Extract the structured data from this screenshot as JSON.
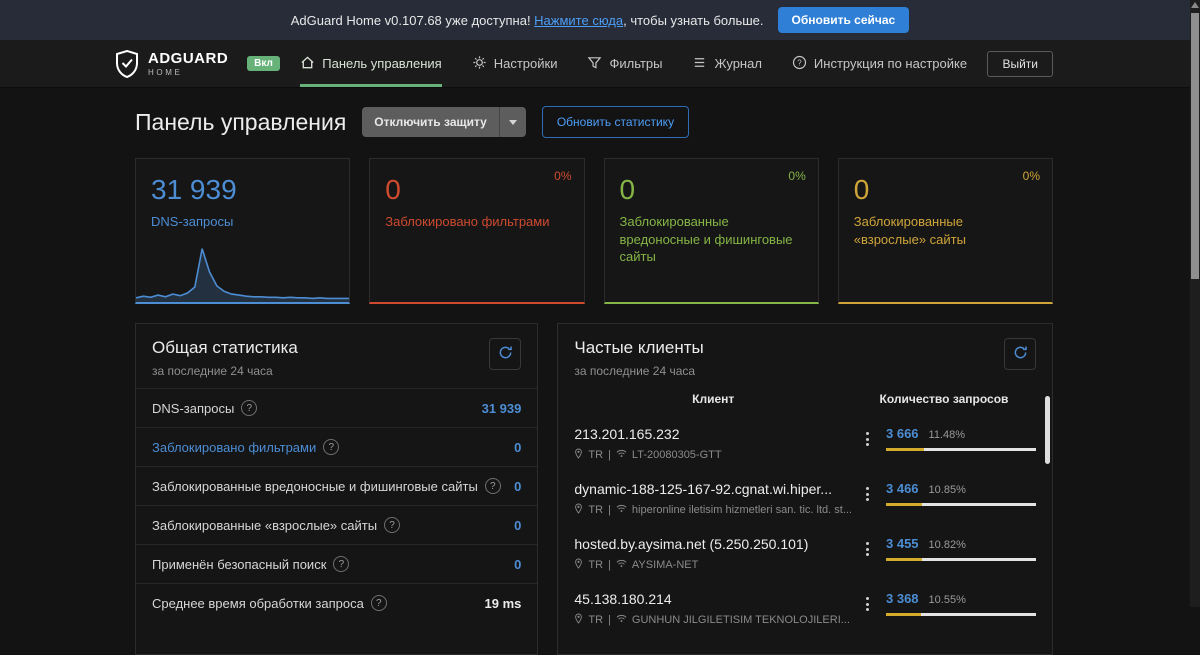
{
  "colors": {
    "accent_blue": "#4c8dd4",
    "red": "#cf4a2f",
    "green": "#85b546",
    "yellow": "#cfa53a",
    "link_blue": "#4d9ef7",
    "nav_active_green": "#67b279",
    "bar_yellow": "#d4ab2a",
    "bar_track": "#e3e3e3"
  },
  "icons": {
    "help_glyph": "?"
  },
  "notification": {
    "message_prefix": "AdGuard Home v0.107.68 уже доступна! ",
    "link_label": "Нажмите сюда",
    "message_suffix": ", чтобы узнать больше.",
    "update_button_label": "Обновить сейчас"
  },
  "header": {
    "brand_name": "ADGUARD",
    "brand_subtitle": "HOME",
    "status_badge": "Вкл",
    "nav_items": [
      {
        "label": "Панель управления",
        "icon": "dashboard-icon",
        "active": true
      },
      {
        "label": "Настройки",
        "icon": "gear-icon",
        "active": false
      },
      {
        "label": "Фильтры",
        "icon": "filter-icon",
        "active": false
      },
      {
        "label": "Журнал",
        "icon": "journal-icon",
        "active": false
      },
      {
        "label": "Инструкция по настройке",
        "icon": "help-icon",
        "active": false
      }
    ],
    "logout_label": "Выйти"
  },
  "page": {
    "title": "Панель управления",
    "disable_protection_label": "Отключить защиту",
    "refresh_statistics_label": "Обновить статистику"
  },
  "cards": [
    {
      "value": "31 939",
      "label": "DNS-запросы",
      "color": "#4c8dd4",
      "sparkline": [
        4,
        7,
        5,
        9,
        6,
        11,
        8,
        13,
        24,
        95,
        52,
        26,
        16,
        11,
        9,
        7,
        6,
        6,
        5,
        5,
        4,
        5,
        4,
        4,
        3,
        4,
        3,
        3,
        3,
        3
      ]
    },
    {
      "value": "0",
      "label": "Заблокировано фильтрами",
      "percent": "0%",
      "color": "#cf4a2f"
    },
    {
      "value": "0",
      "label": "Заблокированные вредоносные и фишинговые сайты",
      "percent": "0%",
      "color": "#85b546"
    },
    {
      "value": "0",
      "label": "Заблокированные «взрослые» сайты",
      "percent": "0%",
      "color": "#cfa53a"
    }
  ],
  "general_stats": {
    "title": "Общая статистика",
    "subtitle": "за последние 24 часа",
    "rows": [
      {
        "label": "DNS-запросы",
        "value": "31 939"
      },
      {
        "label": "Заблокировано фильтрами",
        "value": "0"
      },
      {
        "label": "Заблокированные вредоносные и фишинговые сайты",
        "value": "0"
      },
      {
        "label": "Заблокированные «взрослые» сайты",
        "value": "0"
      },
      {
        "label": "Применён безопасный поиск",
        "value": "0"
      },
      {
        "label": "Среднее время обработки запроса",
        "value": "19 ms"
      }
    ]
  },
  "top_clients": {
    "title": "Частые клиенты",
    "subtitle": "за последние 24 часа",
    "meta_separator": "|",
    "columns": {
      "client": "Клиент",
      "count": "Количество запросов"
    },
    "rows": [
      {
        "name": "213.201.165.232",
        "country": "TR",
        "network": "LT-20080305-GTT",
        "count": "3 666",
        "percent": "11.48%",
        "bar_fill": 25
      },
      {
        "name": "dynamic-188-125-167-92.cgnat.wi.hiper...",
        "country": "TR",
        "network": "hiperonline iletisim hizmetleri san. tic. ltd. st...",
        "count": "3 466",
        "percent": "10.85%",
        "bar_fill": 24
      },
      {
        "name": "hosted.by.aysima.net (5.250.250.101)",
        "country": "TR",
        "network": "AYSIMA-NET",
        "count": "3 455",
        "percent": "10.82%",
        "bar_fill": 24
      },
      {
        "name": "45.138.180.214",
        "country": "TR",
        "network": "GUNHUN JILGILETISIM TEKNOLOJILERI...",
        "count": "3 368",
        "percent": "10.55%",
        "bar_fill": 23
      }
    ]
  }
}
